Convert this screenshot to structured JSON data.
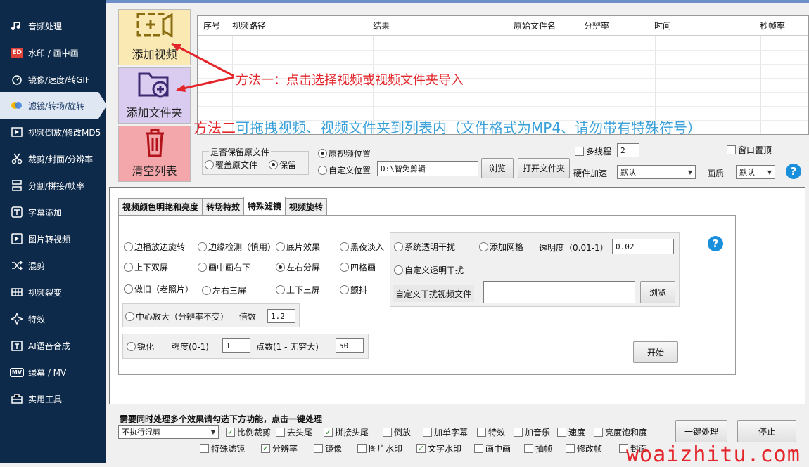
{
  "sidebar": {
    "items": [
      {
        "label": "音频处理",
        "icon": "music-note-icon"
      },
      {
        "label": "水印 / 画中画",
        "icon": "watermark-icon"
      },
      {
        "label": "镜像/速度/转GIF",
        "icon": "speed-icon"
      },
      {
        "label": "滤镜/转场/旋转",
        "icon": "filter-icon"
      },
      {
        "label": "视频倒放/修改MD5",
        "icon": "reverse-icon"
      },
      {
        "label": "裁剪/封面/分辨率",
        "icon": "scissors-icon"
      },
      {
        "label": "分割/拼接/帧率",
        "icon": "split-icon"
      },
      {
        "label": "字幕添加",
        "icon": "subtitle-icon"
      },
      {
        "label": "图片转视频",
        "icon": "image-video-icon"
      },
      {
        "label": "混剪",
        "icon": "shuffle-icon"
      },
      {
        "label": "视频裂变",
        "icon": "fission-icon"
      },
      {
        "label": "特效",
        "icon": "sparkle-icon"
      },
      {
        "label": "AI语音合成",
        "icon": "ai-voice-icon"
      },
      {
        "label": "绿幕 / MV",
        "icon": "mv-icon"
      },
      {
        "label": "实用工具",
        "icon": "toolbox-icon"
      }
    ],
    "active_index": 3
  },
  "big_buttons": {
    "add_video": "添加视频",
    "add_folder": "添加文件夹",
    "clear_list": "清空列表"
  },
  "file_list": {
    "columns": [
      "序号",
      "视频路径",
      "结果",
      "原始文件名",
      "分辨率",
      "时间",
      "秒帧率"
    ]
  },
  "annotations": {
    "method1": "方法一：点击选择视频或视频文件夹导入",
    "method2_prefix": "方法二",
    "method2_text": "可拖拽视频、视频文件夹到列表内（文件格式为MP4、请勿带有特殊符号）"
  },
  "options": {
    "keep_original_label": "是否保留原文件",
    "overwrite": "覆盖原文件",
    "keep": "保留",
    "orig_position": "原视频位置",
    "custom_position": "自定义位置",
    "output_path": "D:\\智免剪辑",
    "browse": "浏览",
    "open_folder": "打开文件夹",
    "multithread": "多线程",
    "thread_count": "2",
    "window_top": "窗口置顶",
    "hw_accel_label": "硬件加速",
    "hw_accel_value": "默认",
    "quality_label": "画质",
    "quality_value": "默认"
  },
  "tabs": [
    "视频颜色明艳和亮度",
    "转场特效",
    "特殊滤镜",
    "视频旋转"
  ],
  "filters": {
    "row1": [
      "边播放边旋转",
      "边缘检测（慎用）",
      "底片效果",
      "黑夜淡入"
    ],
    "row2": [
      "上下双屏",
      "画中画右下",
      "左右分屏",
      "四格画"
    ],
    "row3": [
      "做旧（老照片）",
      "左右三屏",
      "上下三屏",
      "颤抖"
    ],
    "zoom_label": "中心放大（分辨率不变）",
    "multiplier_label": "倍数",
    "multiplier_value": "1.2",
    "sharpen_label": "锐化",
    "strength_label": "强度(0-1)",
    "strength_value": "1",
    "points_label": "点数(1 - 无穷大)",
    "points_value": "50",
    "sys_noise": "系统透明干扰",
    "add_grid": "添加网格",
    "opacity_label": "透明度（0.01-1）",
    "opacity_value": "0.02",
    "custom_noise": "自定义透明干扰",
    "custom_noise_file": "自定义干扰视频文件",
    "browse": "浏览",
    "start": "开始"
  },
  "batch": {
    "title": "需要同时处理多个效果请勾选下方功能，点击一键处理",
    "mix_value": "不执行混剪",
    "row1": [
      {
        "label": "比例裁剪",
        "checked": true
      },
      {
        "label": "去头尾",
        "checked": false
      },
      {
        "label": "拼接头尾",
        "checked": true
      },
      {
        "label": "倒放",
        "checked": false
      },
      {
        "label": "加单字幕",
        "checked": false
      },
      {
        "label": "特效",
        "checked": false
      },
      {
        "label": "加音乐",
        "checked": false
      },
      {
        "label": "速度",
        "checked": false
      },
      {
        "label": "亮度饱和度",
        "checked": false
      }
    ],
    "row2": [
      {
        "label": "特殊滤镜",
        "checked": false
      },
      {
        "label": "分辨率",
        "checked": true
      },
      {
        "label": "镜像",
        "checked": false
      },
      {
        "label": "图片水印",
        "checked": false
      },
      {
        "label": "文字水印",
        "checked": true
      },
      {
        "label": "画中画",
        "checked": false
      },
      {
        "label": "抽帧",
        "checked": false
      },
      {
        "label": "修改帧",
        "checked": false
      },
      {
        "label": "封面",
        "checked": false
      }
    ],
    "one_click": "一键处理",
    "stop": "停止"
  },
  "watermark": "woaizhitu.com",
  "colors": {
    "sidebar_bg": "#0e2a4a",
    "annotation_red": "#e3262b",
    "annotation_blue": "#3aa0d8"
  }
}
